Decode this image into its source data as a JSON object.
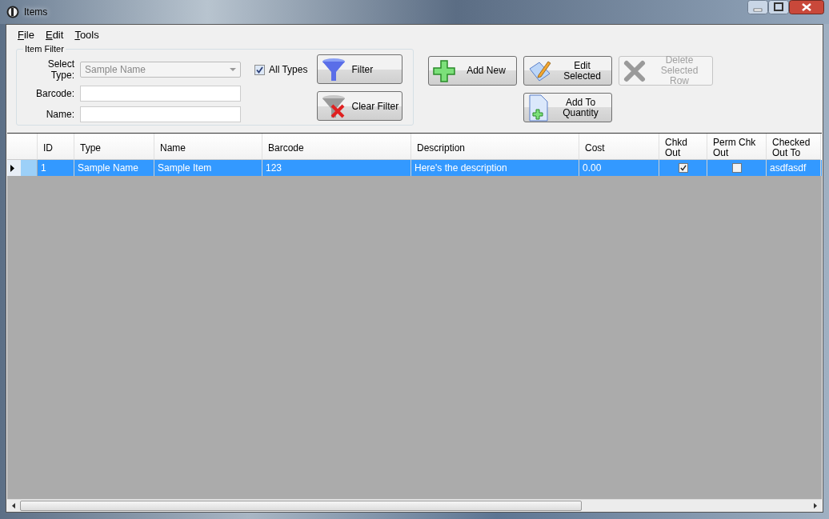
{
  "window": {
    "title": "Items"
  },
  "menu": [
    {
      "label": "File"
    },
    {
      "label": "Edit"
    },
    {
      "label": "Tools"
    }
  ],
  "item_filter": {
    "title": "Item Filter",
    "select_type": {
      "label": "Select Type:",
      "value": "Sample Name",
      "disabled": true
    },
    "barcode": {
      "label": "Barcode:"
    },
    "name": {
      "label": "Name:"
    },
    "all_types": {
      "label": "All Types",
      "checked": true
    },
    "buttons": [
      {
        "label": "Filter",
        "kind": "filter"
      },
      {
        "label": "Clear Filter",
        "kind": "clear"
      }
    ]
  },
  "actions": [
    {
      "label": "Add New",
      "kind": "add",
      "disabled": false
    },
    {
      "label": "Edit Selected",
      "kind": "edit",
      "disabled": false
    },
    {
      "label": "Delete Selected Row",
      "kind": "delete",
      "disabled": true
    },
    {
      "label": "Add To Quantity",
      "kind": "quantity",
      "disabled": false
    }
  ],
  "table": {
    "columns": [
      "ID",
      "Type",
      "Name",
      "Barcode",
      "Description",
      "Cost",
      "Chkd Out",
      "Perm Chk Out",
      "Checked Out To"
    ],
    "rows": [
      {
        "selected": true,
        "cells": [
          "1",
          "Sample Name",
          "Sample Item",
          "123",
          "Here's the description",
          "0.00"
        ],
        "chkd_out": true,
        "perm_chk_out": false,
        "checked_out_to": "asdfasdf"
      }
    ]
  }
}
